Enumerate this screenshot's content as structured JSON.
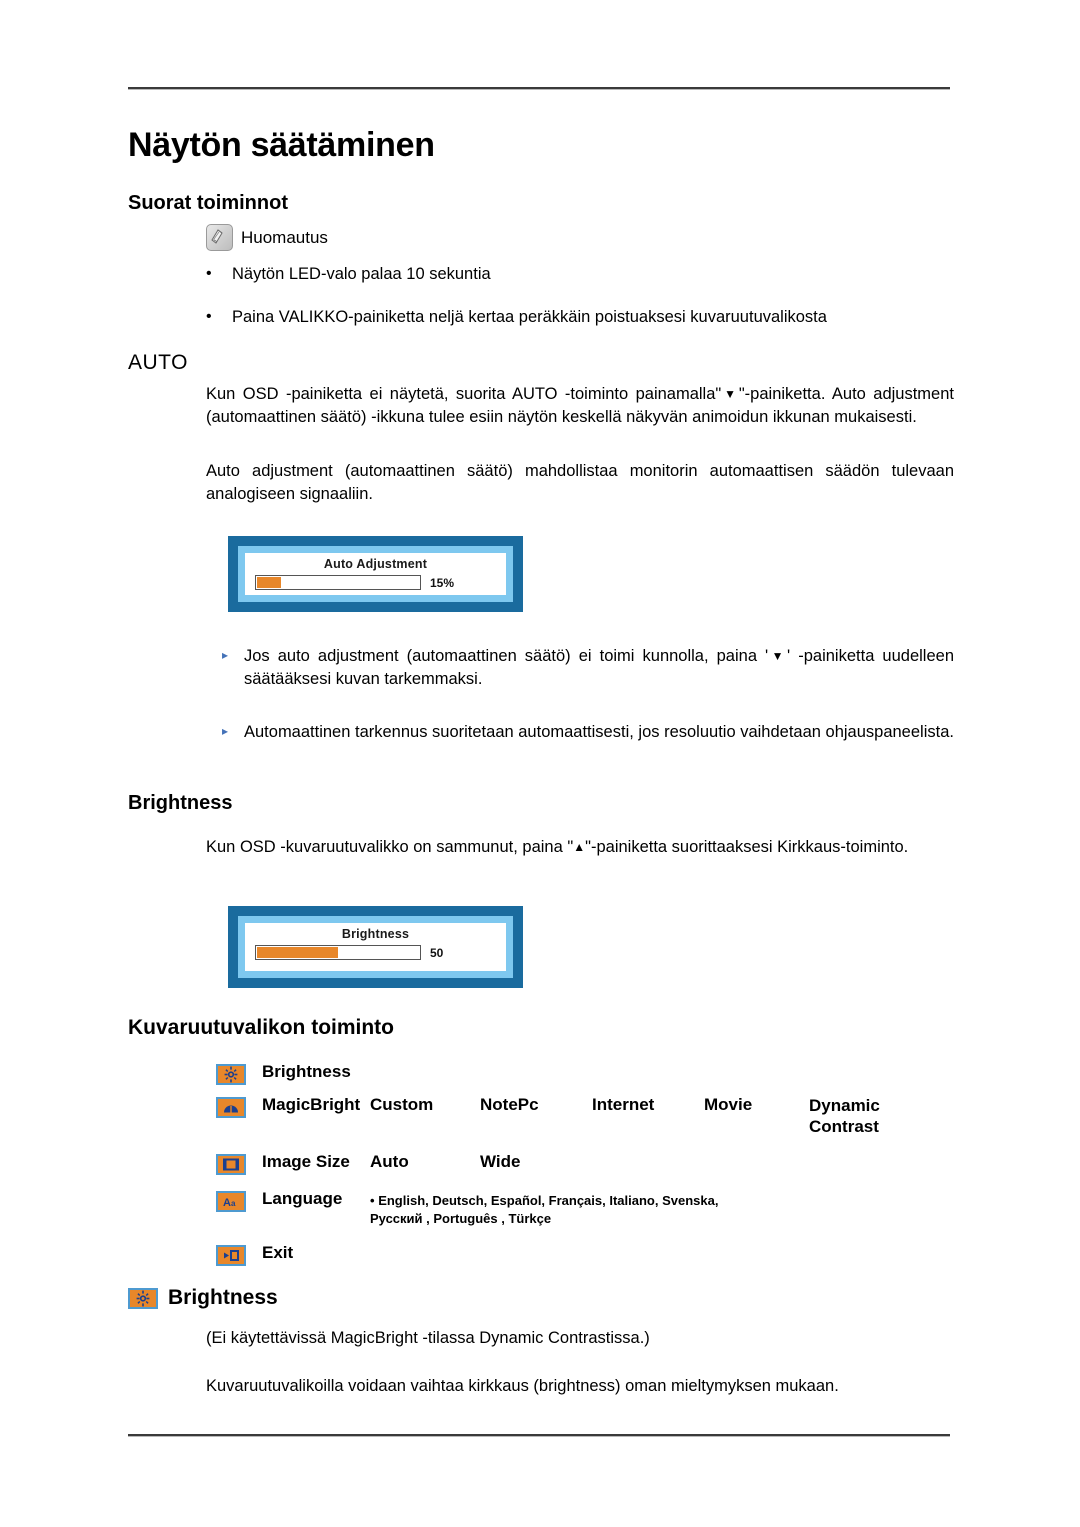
{
  "document": {
    "title": "Näytön säätäminen",
    "section_suorat": "Suorat toiminnot",
    "note": {
      "icon": "note-hand-icon",
      "label": "Huomautus"
    },
    "bullets": [
      {
        "marker": "•",
        "text": "Näytön LED-valo palaa 10 sekuntia"
      },
      {
        "marker": "•",
        "text": "Paina VALIKKO-painiketta neljä kertaa peräkkäin poistuaksesi kuvaruutuvalikosta"
      }
    ],
    "auto": {
      "heading": "AUTO",
      "paragraph1_a": "Kun OSD -painiketta ei näytetä, suorita AUTO -toiminto painamalla\"",
      "paragraph1_glyph": "▼",
      "paragraph1_b": "\"-painiketta. Auto adjustment (automaattinen säätö) -ikkuna tulee esiin näytön keskellä näkyvän animoidun ikkunan mukaisesti.",
      "paragraph2": "Auto adjustment (automaattinen säätö) mahdollistaa monitorin automaattisen säädön tulevaan analogiseen signaaliin.",
      "osd": {
        "title": "Auto Adjustment",
        "value": "15%",
        "fill_percent": 15
      },
      "arrow_bullets": [
        {
          "marker": "▸",
          "text_a": "Jos auto adjustment (automaattinen säätö) ei toimi kunnolla, paina '",
          "glyph": "▼",
          "text_b": "' -painiketta uudelleen säätääksesi kuvan tarkemmaksi."
        },
        {
          "marker": "▸",
          "text_a": "Automaattinen tarkennus suoritetaan automaattisesti, jos resoluutio vaihdetaan ohjauspaneelista.",
          "glyph": "",
          "text_b": ""
        }
      ]
    },
    "brightness_section": {
      "heading": "Brightness",
      "paragraph_a": "Kun OSD -kuvaruutuvalikko on sammunut, paina \"",
      "paragraph_glyph": "▲",
      "paragraph_b": "\"-painiketta suorittaaksesi Kirkkaus-toiminto.",
      "osd": {
        "title": "Brightness",
        "value": "50",
        "fill_percent": 50
      }
    },
    "osd_menu": {
      "heading": "Kuvaruutuvalikon toiminto",
      "rows": [
        {
          "icon": "brightness-sun-icon",
          "label": "Brightness",
          "options": []
        },
        {
          "icon": "magicbright-icon",
          "label": "MagicBright",
          "options": [
            "Custom",
            "NotePc",
            "Internet",
            "Movie",
            "Dynamic Contrast"
          ]
        },
        {
          "icon": "image-size-icon",
          "label": "Image Size",
          "options": [
            "Auto",
            "Wide"
          ]
        },
        {
          "icon": "language-icon",
          "label": "Language",
          "languages_line1": "English, Deutsch, Español, Français,  Italiano, Svenska,",
          "languages_line2": "Русский , Português , Türkçe",
          "lang_bullet": "•"
        },
        {
          "icon": "exit-icon",
          "label": "Exit",
          "options": []
        }
      ]
    },
    "brightness_detail": {
      "icon": "brightness-sun-icon",
      "heading": "Brightness",
      "note": "(Ei käytettävissä MagicBright -tilassa Dynamic Contrastissa.)",
      "body": "Kuvaruutuvalikoilla voidaan vaihtaa kirkkaus (brightness) oman mieltymyksen mukaan."
    },
    "colors": {
      "osd_outer_border": "#1a6b9e",
      "osd_inner_border": "#7ec8ef",
      "bar_fill": "#e8872a",
      "icon_fill": "#e8872a",
      "icon_border": "#4e9ad0",
      "arrow_bullet": "#4472b8"
    }
  }
}
